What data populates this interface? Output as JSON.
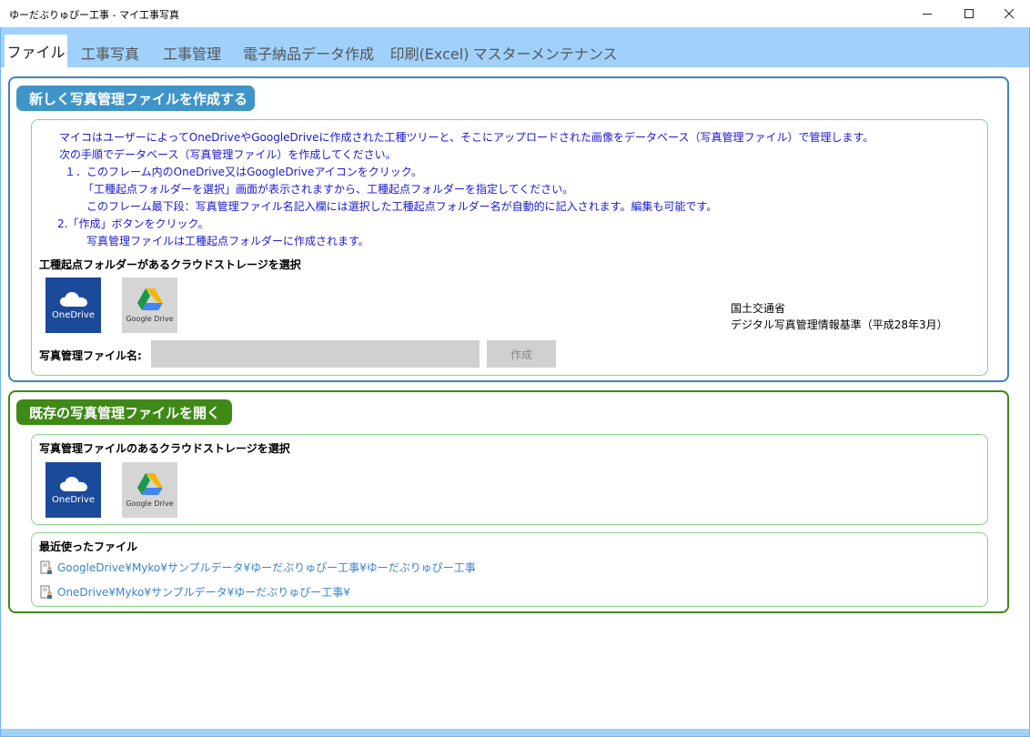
{
  "window": {
    "title": "ゆーだぶりゅぴー工事 - マイ工事写真",
    "controls": {
      "minimize": "minimize-icon",
      "maximize": "maximize-icon",
      "close": "close-icon"
    }
  },
  "tabs": [
    {
      "label": "ファイル",
      "active": true
    },
    {
      "label": "工事写真",
      "active": false
    },
    {
      "label": "工事管理",
      "active": false
    },
    {
      "label": "電子納品データ作成",
      "active": false
    },
    {
      "label": "印刷(Excel)",
      "active": false
    },
    {
      "label": "マスターメンテナンス",
      "active": false
    }
  ],
  "new_section": {
    "header": "新しく写真管理ファイルを作成する",
    "instructions": [
      "マイコはユーザーによってOneDriveやGoogleDriveに作成された工種ツリーと、そこにアップロードされた画像をデータベース（写真管理ファイル）で管理します。",
      "次の手順でデータベース（写真管理ファイル）を作成してください。",
      "１．このフレーム内のOneDrive又はGoogleDriveアイコンをクリック。",
      "「工種起点フォルダーを選択」画面が表示されますから、工種起点フォルダーを指定してください。",
      "このフレーム最下段：写真管理ファイル名記入欄には選択した工種起点フォルダー名が自動的に記入されます。編集も可能です。",
      "2.「作成」ボタンをクリック。",
      "写真管理ファイルは工種起点フォルダーに作成されます。"
    ],
    "storage_label": "工種起点フォルダーがあるクラウドストレージを選択",
    "onedrive_label": "OneDrive",
    "gdrive_label": "Google Drive",
    "reference_line1": "国土交通省",
    "reference_line2": "デジタル写真管理情報基準（平成28年3月）",
    "filename_label": "写真管理ファイル名:",
    "filename_value": "",
    "create_button": "作成"
  },
  "open_section": {
    "header": "既存の写真管理ファイルを開く",
    "storage_label": "写真管理ファイルのあるクラウドストレージを選択",
    "onedrive_label": "OneDrive",
    "gdrive_label": "Google Drive",
    "recent_label": "最近使ったファイル",
    "recent_files": [
      "GoogleDrive¥Myko¥サンプルデータ¥ゆーだぶりゅぴー工事¥ゆーだぶりゅぴー工事",
      "OneDrive¥Myko¥サンプルデータ¥ゆーだぶりゅぴー工事¥"
    ]
  },
  "colors": {
    "tabbar": "#9fd1fb",
    "blue_header": "#3f95c8",
    "green_header": "#3f8a16",
    "instruction_text": "#1a1acf",
    "link_text": "#3a84c9",
    "onedrive_tile": "#1c4a9a"
  }
}
